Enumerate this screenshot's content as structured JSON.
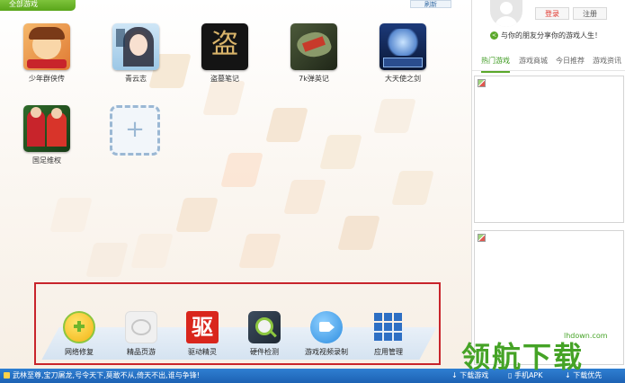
{
  "top": {
    "all_games_label": "全部游戏",
    "top_right_label": "刷新"
  },
  "games": [
    {
      "label": "少年群侠传",
      "icon": "shaonian-qunxia-icon"
    },
    {
      "label": "青云志",
      "icon": "qingyunzhi-icon"
    },
    {
      "label": "盗墓笔记",
      "icon": "daomu-biji-icon"
    },
    {
      "label": "7k弹英记",
      "icon": "7k-game-icon"
    },
    {
      "label": "大天使之剑",
      "icon": "archangel-sword-icon"
    },
    {
      "label": "国足维权",
      "icon": "football-icon"
    }
  ],
  "add_tile_symbol": "+",
  "tools": [
    {
      "label": "网络修复",
      "icon": "network-repair-icon"
    },
    {
      "label": "精品页游",
      "icon": "web-games-icon"
    },
    {
      "label": "驱动精灵",
      "icon": "driver-genius-icon",
      "glyph": "驱"
    },
    {
      "label": "硬件检测",
      "icon": "hardware-check-icon"
    },
    {
      "label": "游戏视频录制",
      "icon": "video-record-icon"
    },
    {
      "label": "应用管理",
      "icon": "app-manager-icon"
    }
  ],
  "status": {
    "marquee": "武林至尊,宝刀屠龙,号令天下,莫敢不从,倚天不出,谁与争锋!",
    "items": [
      "下载游戏",
      "手机APK",
      "下载优先"
    ]
  },
  "sidebar": {
    "login_label": "登录",
    "register_label": "注册",
    "share_text": "与你的朋友分享你的游戏人生！",
    "tabs": [
      {
        "label": "热门游戏",
        "active": true
      },
      {
        "label": "游戏商城",
        "active": false
      },
      {
        "label": "今日推荐",
        "active": false
      },
      {
        "label": "游戏资讯",
        "active": false
      }
    ]
  },
  "watermark": {
    "text": "领航下载",
    "url": "lhdown.com"
  },
  "colors": {
    "accent_green": "#5aa82a",
    "status_blue": "#1d62b3",
    "highlight_red": "#c8242b"
  }
}
